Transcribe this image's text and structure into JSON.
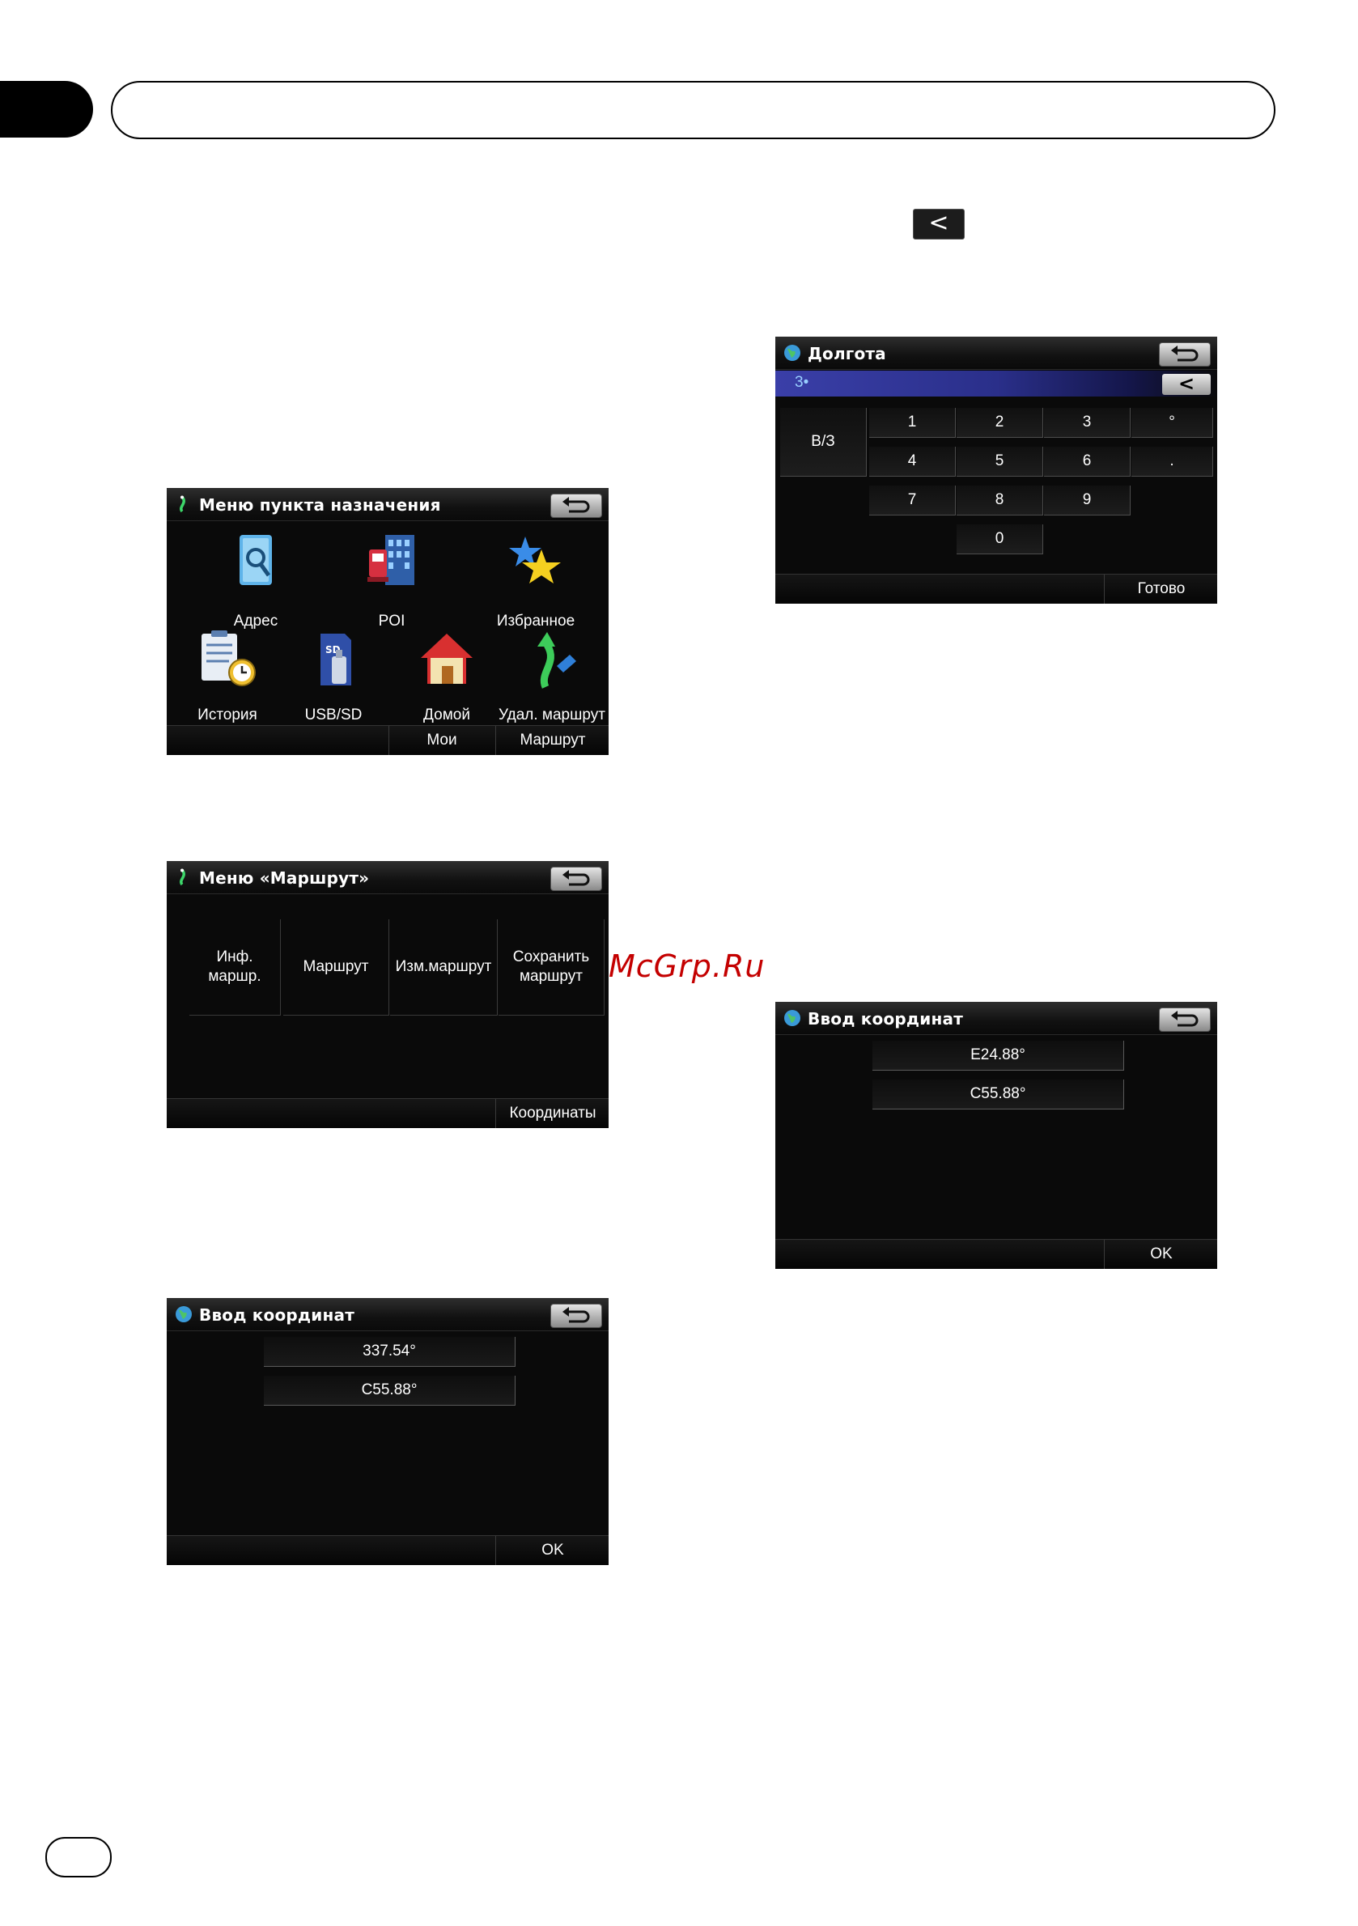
{
  "page": {
    "back_key": "<",
    "watermark": "McGrp.Ru"
  },
  "screens": {
    "destination_menu": {
      "title": "Меню пункта назначения",
      "items": [
        "Адрес",
        "POI",
        "Избранное",
        "История",
        "USB/SD",
        "Домой",
        "Удал. маршрут"
      ],
      "footer": [
        "Мои маршруты",
        "Маршрут"
      ]
    },
    "route_menu": {
      "title": "Меню «Маршрут»",
      "buttons": [
        "Инф.\nмаршр.",
        "Маршрут",
        "Изм.маршрут",
        "Сохранить\nмаршрут"
      ],
      "footer": [
        "Координаты"
      ]
    },
    "coord_entry_1": {
      "title": "Ввод координат",
      "fields": [
        "337.54°",
        "С55.88°"
      ],
      "ok": "OK"
    },
    "longitude_keypad": {
      "title": "Долгота",
      "input": "3•",
      "backspace": "<",
      "ew": "В/З",
      "keys": [
        "1",
        "2",
        "3",
        "°",
        "4",
        "5",
        "6",
        ".",
        "7",
        "8",
        "9",
        "0"
      ],
      "done": "Готово"
    },
    "coord_entry_2": {
      "title": "Ввод координат",
      "fields": [
        "E24.88°",
        "С55.88°"
      ],
      "ok": "OK"
    }
  }
}
